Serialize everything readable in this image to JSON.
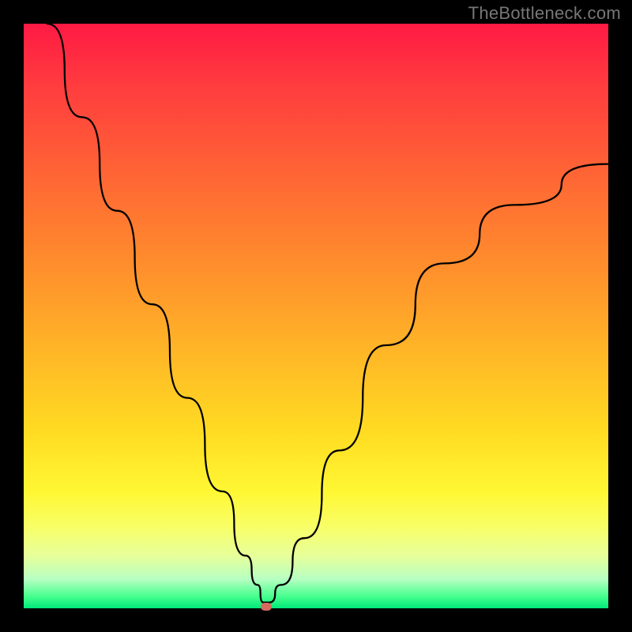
{
  "watermark": "TheBottleneck.com",
  "chart_data": {
    "type": "line",
    "title": "",
    "xlabel": "",
    "ylabel": "",
    "xlim": [
      0,
      100
    ],
    "ylim": [
      0,
      100
    ],
    "series": [
      {
        "name": "curve",
        "x": [
          4,
          10,
          16,
          22,
          28,
          34,
          38,
          40,
          41,
          42,
          44,
          48,
          54,
          62,
          72,
          84,
          100
        ],
        "y": [
          100,
          84,
          68,
          52,
          36,
          20,
          9,
          4,
          1,
          1,
          4,
          12,
          27,
          45,
          59,
          69,
          76
        ]
      }
    ],
    "marker": {
      "x": 41.5,
      "y": 0.3
    },
    "background_gradient": [
      "#ff1a44",
      "#ffb327",
      "#fff733",
      "#00e87a"
    ]
  }
}
